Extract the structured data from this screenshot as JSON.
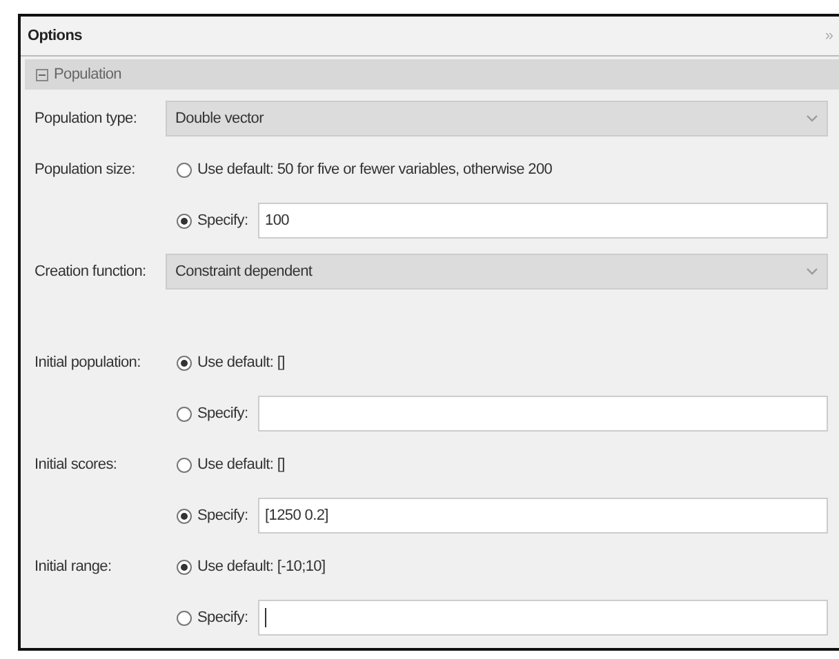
{
  "panel": {
    "title": "Options",
    "collapse_glyph": "»"
  },
  "section": {
    "title": "Population",
    "expanded": true
  },
  "groups": [
    [
      {
        "label": "Population type:",
        "kind": "dropdown",
        "value": "Double vector"
      },
      {
        "label": "Population size:",
        "kind": "choice",
        "options": [
          {
            "kind": "default",
            "text": "Use default: 50 for five or fewer variables, otherwise 200",
            "selected": false
          },
          {
            "kind": "specify",
            "text": "Specify:",
            "value": "100",
            "selected": true
          }
        ]
      },
      {
        "label": "Creation function:",
        "kind": "dropdown",
        "value": "Constraint dependent"
      }
    ],
    [
      {
        "label": "Initial population:",
        "kind": "choice",
        "options": [
          {
            "kind": "default",
            "text": "Use default: []",
            "selected": true
          },
          {
            "kind": "specify",
            "text": "Specify:",
            "selected": false
          }
        ]
      },
      {
        "label": "Initial scores:",
        "kind": "choice",
        "options": [
          {
            "kind": "default",
            "text": "Use default: []",
            "selected": false
          },
          {
            "kind": "specify",
            "text": "Specify:",
            "value": "[1250 0.2]",
            "selected": true
          }
        ]
      },
      {
        "label": "Initial range:",
        "kind": "choice",
        "options": [
          {
            "kind": "default",
            "text": "Use default: [-10;10]",
            "selected": true
          },
          {
            "kind": "specify",
            "text": "Specify:",
            "selected": false,
            "focused": true
          }
        ]
      }
    ]
  ]
}
